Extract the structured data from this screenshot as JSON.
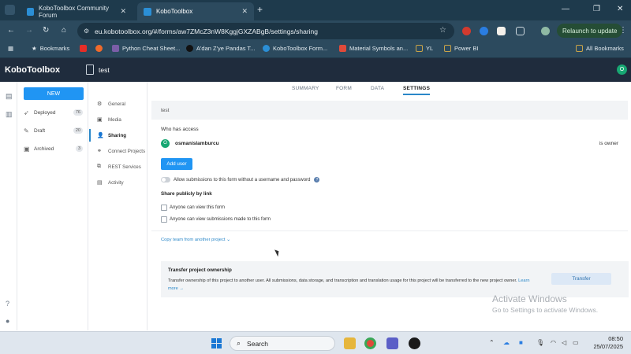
{
  "browser": {
    "tabs": [
      {
        "label": "KoboToolbox Community Forum",
        "active": false
      },
      {
        "label": "KoboToolbox",
        "active": true
      }
    ],
    "url": "eu.kobotoolbox.org/#/forms/aw7ZMcZ3nW8KggjGXZABgB/settings/sharing",
    "relaunch_label": "Relaunch to update",
    "bookmarks": [
      {
        "label": "Bookmarks",
        "color": "#e6eef3"
      },
      {
        "label": "Python Cheat Sheet...",
        "color": "#7b5ea7"
      },
      {
        "label": "A'dan Z'ye Pandas T...",
        "color": "#222222"
      },
      {
        "label": "KoboToolbox Form...",
        "color": "#2b8fd6"
      },
      {
        "label": "Material Symbols an...",
        "color": "#e04a3a"
      },
      {
        "label": "YL",
        "color": "#c9a348"
      },
      {
        "label": "Power BI",
        "color": "#c9a348"
      }
    ],
    "all_bookmarks": "All Bookmarks"
  },
  "app": {
    "logo": "KoboToolbox",
    "project_name": "test",
    "user_initial": "O"
  },
  "sidebar": {
    "new_label": "NEW",
    "items": [
      {
        "label": "Deployed",
        "count": "76",
        "icon": "rocket-icon"
      },
      {
        "label": "Draft",
        "count": "20",
        "icon": "draft-icon"
      },
      {
        "label": "Archived",
        "count": "3",
        "icon": "archive-icon"
      }
    ]
  },
  "settings_nav": {
    "items": [
      {
        "label": "General",
        "icon": "gear-icon"
      },
      {
        "label": "Media",
        "icon": "media-icon"
      },
      {
        "label": "Sharing",
        "icon": "users-icon",
        "active": true
      },
      {
        "label": "Connect Projects",
        "icon": "link-icon"
      },
      {
        "label": "REST Services",
        "icon": "rest-icon"
      },
      {
        "label": "Activity",
        "icon": "activity-icon"
      }
    ]
  },
  "subtabs": {
    "items": [
      {
        "label": "SUMMARY"
      },
      {
        "label": "FORM"
      },
      {
        "label": "DATA"
      },
      {
        "label": "SETTINGS",
        "active": true
      }
    ]
  },
  "sharing": {
    "project_title": "test",
    "who_has_access": "Who has access",
    "user": {
      "initial": "O",
      "name": "osmanislamburcu",
      "role": "is owner"
    },
    "add_user": "Add user",
    "allow_anon": "Allow submissions to this form without a username and password",
    "share_publicly": "Share publicly by link",
    "opt_view_form": "Anyone can view this form",
    "opt_view_submissions": "Anyone can view submissions made to this form",
    "copy_team": "Copy team from another project",
    "transfer": {
      "title": "Transfer project ownership",
      "desc": "Transfer ownership of this project to another user. All submissions, data storage, and transcription and translation usage for this project will be transferred to the new project owner.",
      "learn_more": "Learn more →",
      "button": "Transfer"
    }
  },
  "watermark": {
    "line1": "Activate Windows",
    "line2": "Go to Settings to activate Windows."
  },
  "taskbar": {
    "search_placeholder": "Search",
    "time": "08:50",
    "date": "25/07/2025"
  }
}
